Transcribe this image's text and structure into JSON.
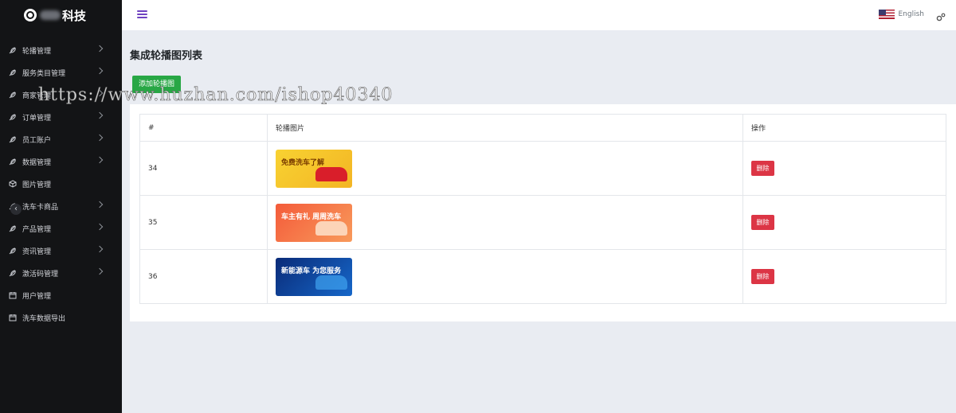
{
  "brand": {
    "name": "科技",
    "logo_icon": "logo-icon"
  },
  "sidebar": {
    "items": [
      {
        "label": "轮播管理",
        "icon": "feather-icon",
        "has_children": true
      },
      {
        "label": "服务类目管理",
        "icon": "feather-icon",
        "has_children": true
      },
      {
        "label": "商家管理",
        "icon": "feather-icon",
        "has_children": true
      },
      {
        "label": "订单管理",
        "icon": "feather-icon",
        "has_children": true
      },
      {
        "label": "员工账户",
        "icon": "feather-icon",
        "has_children": true
      },
      {
        "label": "数据管理",
        "icon": "feather-icon",
        "has_children": true
      },
      {
        "label": "图片管理",
        "icon": "cube-icon",
        "has_children": false
      },
      {
        "label": "洗车卡商品",
        "icon": "feather-icon",
        "has_children": true
      },
      {
        "label": "产品管理",
        "icon": "feather-icon",
        "has_children": true
      },
      {
        "label": "资讯管理",
        "icon": "feather-icon",
        "has_children": true
      },
      {
        "label": "激活码管理",
        "icon": "feather-icon",
        "has_children": true
      },
      {
        "label": "用户管理",
        "icon": "calendar-icon",
        "has_children": false
      },
      {
        "label": "洗车数据导出",
        "icon": "calendar-icon",
        "has_children": false
      }
    ]
  },
  "topbar": {
    "language": "English",
    "menu_icon": "hamburger-icon",
    "settings_icon": "gears-icon"
  },
  "page": {
    "title": "集成轮播图列表",
    "add_button": "添加轮播图"
  },
  "table": {
    "headers": [
      "#",
      "轮播图片",
      "操作"
    ],
    "rows": [
      {
        "id": "34",
        "banner_text": "免费洗车了解",
        "delete_label": "删除"
      },
      {
        "id": "35",
        "banner_text": "车主有礼 周周洗车",
        "delete_label": "删除"
      },
      {
        "id": "36",
        "banner_text": "新能源车 为您服务",
        "delete_label": "删除"
      }
    ]
  },
  "watermark": "https://www.huzhan.com/ishop40340",
  "colors": {
    "sidebar_bg": "#131416",
    "add_button": "#28a745",
    "delete_button": "#dc3545",
    "accent": "#6f42c1"
  }
}
